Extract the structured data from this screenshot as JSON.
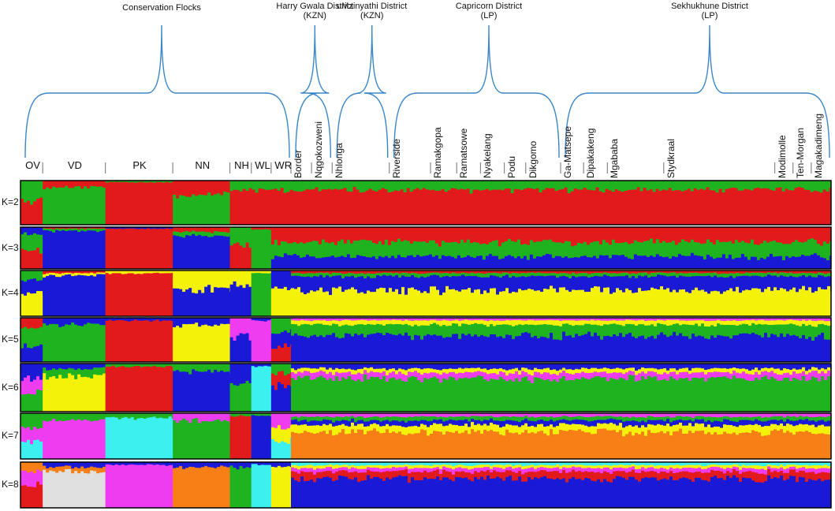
{
  "chart_data": {
    "type": "stacked-bar",
    "description_axis": "individual ancestry proportions",
    "group_titles": [
      {
        "id": "conservation",
        "text": [
          "Conservation Flocks"
        ]
      },
      {
        "id": "harry_gwala",
        "text": [
          "Harry Gwala District",
          "(KZN)"
        ]
      },
      {
        "id": "umzinyathi",
        "text": [
          "uMzinyathi District",
          "(KZN)"
        ]
      },
      {
        "id": "capricorn",
        "text": [
          "Capricorn District",
          "(LP)"
        ]
      },
      {
        "id": "sekhukhune",
        "text": [
          "Sekhukhune District",
          "(LP)"
        ]
      }
    ],
    "populations": [
      {
        "name": "OV",
        "rotated": false,
        "share": 0.028
      },
      {
        "name": "VD",
        "rotated": false,
        "share": 0.079
      },
      {
        "name": "PK",
        "rotated": false,
        "share": 0.085
      },
      {
        "name": "NN",
        "rotated": false,
        "share": 0.072
      },
      {
        "name": "NH",
        "rotated": false,
        "share": 0.027
      },
      {
        "name": "WL",
        "rotated": false,
        "share": 0.025
      },
      {
        "name": "WR",
        "rotated": false,
        "share": 0.025
      },
      {
        "name": "Border",
        "rotated": true,
        "share": 0.026
      },
      {
        "name": "Nqgokozweni",
        "rotated": true,
        "share": 0.026
      },
      {
        "name": "Nhlonga",
        "rotated": true,
        "share": 0.072
      },
      {
        "name": "Riverside",
        "rotated": true,
        "share": 0.052
      },
      {
        "name": "Ramakgopa",
        "rotated": true,
        "share": 0.033
      },
      {
        "name": "Ramatsowe",
        "rotated": true,
        "share": 0.03
      },
      {
        "name": "Nyakelang",
        "rotated": true,
        "share": 0.03
      },
      {
        "name": "Podu",
        "rotated": true,
        "share": 0.027
      },
      {
        "name": "Dikgomo",
        "rotated": true,
        "share": 0.044
      },
      {
        "name": "Ga-Matsepe",
        "rotated": true,
        "share": 0.029
      },
      {
        "name": "Dipakakeng",
        "rotated": true,
        "share": 0.03
      },
      {
        "name": "Mgababa",
        "rotated": true,
        "share": 0.071
      },
      {
        "name": "Stydkraal",
        "rotated": true,
        "share": 0.14
      },
      {
        "name": "Modimolle",
        "rotated": true,
        "share": 0.023
      },
      {
        "name": "Ten-Morgan",
        "rotated": true,
        "share": 0.023
      },
      {
        "name": "Magakadimeng",
        "rotated": true,
        "share": 0.025
      }
    ],
    "k_values": [
      "K=2",
      "K=3",
      "K=4",
      "K=5",
      "K=6",
      "K=7",
      "K=8"
    ],
    "colors": {
      "red": "#e31a1c",
      "green": "#1fb31f",
      "blue": "#1a1ad6",
      "yellow": "#f5f20a",
      "magenta": "#f03cf0",
      "cyan": "#3cf0f0",
      "orange": "#f77f16",
      "grey": "#e0e0e0"
    },
    "panels": [
      {
        "k": "K=2",
        "segments": [
          {
            "pops": [
              "OV"
            ],
            "comp": {
              "red": 0.55,
              "green": 0.45
            }
          },
          {
            "pops": [
              "VD"
            ],
            "comp": {
              "green": 0.85,
              "red": 0.15
            }
          },
          {
            "pops": [
              "PK"
            ],
            "comp": {
              "red": 0.97,
              "green": 0.03
            }
          },
          {
            "pops": [
              "NN"
            ],
            "comp": {
              "green": 0.7,
              "red": 0.3
            }
          },
          {
            "pops": [
              "NH",
              "WL",
              "WR",
              "Border",
              "Nqgokozweni",
              "Nhlonga",
              "Riverside",
              "Ramakgopa",
              "Ramatsowe",
              "Nyakelang",
              "Podu",
              "Dikgomo",
              "Ga-Matsepe",
              "Dipakakeng",
              "Mgababa",
              "Stydkraal",
              "Modimolle",
              "Ten-Morgan",
              "Magakadimeng"
            ],
            "comp": {
              "red": 0.8,
              "green": 0.2
            }
          }
        ]
      },
      {
        "k": "K=3",
        "segments": [
          {
            "pops": [
              "OV"
            ],
            "comp": {
              "red": 0.45,
              "green": 0.4,
              "blue": 0.15
            }
          },
          {
            "pops": [
              "VD"
            ],
            "comp": {
              "blue": 0.92,
              "green": 0.05,
              "red": 0.03
            }
          },
          {
            "pops": [
              "PK"
            ],
            "comp": {
              "red": 0.97,
              "blue": 0.03
            }
          },
          {
            "pops": [
              "NN"
            ],
            "comp": {
              "blue": 0.8,
              "green": 0.1,
              "red": 0.1
            }
          },
          {
            "pops": [
              "NH"
            ],
            "comp": {
              "red": 0.55,
              "green": 0.45
            }
          },
          {
            "pops": [
              "WL"
            ],
            "comp": {
              "green": 0.95,
              "red": 0.05
            }
          },
          {
            "pops": [
              "WR",
              "Border",
              "Nqgokozweni",
              "Nhlonga",
              "Riverside",
              "Ramakgopa",
              "Ramatsowe",
              "Nyakelang",
              "Podu",
              "Dikgomo",
              "Ga-Matsepe",
              "Dipakakeng",
              "Mgababa",
              "Stydkraal",
              "Modimolle",
              "Ten-Morgan",
              "Magakadimeng"
            ],
            "comp": {
              "blue": 0.3,
              "green": 0.35,
              "red": 0.35
            }
          }
        ]
      },
      {
        "k": "K=4",
        "segments": [
          {
            "pops": [
              "OV"
            ],
            "comp": {
              "yellow": 0.5,
              "blue": 0.3,
              "green": 0.2
            }
          },
          {
            "pops": [
              "VD"
            ],
            "comp": {
              "blue": 0.9,
              "yellow": 0.05,
              "red": 0.05
            }
          },
          {
            "pops": [
              "PK"
            ],
            "comp": {
              "red": 0.95,
              "yellow": 0.05
            }
          },
          {
            "pops": [
              "NN"
            ],
            "comp": {
              "blue": 0.6,
              "yellow": 0.4
            }
          },
          {
            "pops": [
              "NH"
            ],
            "comp": {
              "blue": 0.7,
              "yellow": 0.3
            }
          },
          {
            "pops": [
              "WL"
            ],
            "comp": {
              "green": 0.95,
              "yellow": 0.05
            }
          },
          {
            "pops": [
              "WR"
            ],
            "comp": {
              "yellow": 0.6,
              "blue": 0.4
            }
          },
          {
            "pops": [
              "Border",
              "Nqgokozweni",
              "Nhlonga",
              "Riverside",
              "Ramakgopa",
              "Ramatsowe",
              "Nyakelang",
              "Podu",
              "Dikgomo",
              "Ga-Matsepe",
              "Dipakakeng",
              "Mgababa",
              "Stydkraal",
              "Modimolle",
              "Ten-Morgan",
              "Magakadimeng"
            ],
            "comp": {
              "yellow": 0.58,
              "blue": 0.3,
              "green": 0.07,
              "red": 0.05
            }
          }
        ]
      },
      {
        "k": "K=5",
        "segments": [
          {
            "pops": [
              "OV"
            ],
            "comp": {
              "blue": 0.4,
              "green": 0.4,
              "red": 0.2
            }
          },
          {
            "pops": [
              "VD"
            ],
            "comp": {
              "green": 0.85,
              "blue": 0.15
            }
          },
          {
            "pops": [
              "PK"
            ],
            "comp": {
              "red": 0.95,
              "blue": 0.05
            }
          },
          {
            "pops": [
              "NN"
            ],
            "comp": {
              "yellow": 0.85,
              "blue": 0.15
            }
          },
          {
            "pops": [
              "NH"
            ],
            "comp": {
              "blue": 0.6,
              "magenta": 0.4
            }
          },
          {
            "pops": [
              "WL"
            ],
            "comp": {
              "magenta": 0.95,
              "blue": 0.05
            }
          },
          {
            "pops": [
              "WR"
            ],
            "comp": {
              "red": 0.4,
              "blue": 0.3,
              "green": 0.3
            }
          },
          {
            "pops": [
              "Border",
              "Nqgokozweni",
              "Nhlonga",
              "Riverside",
              "Ramakgopa",
              "Ramatsowe",
              "Nyakelang",
              "Podu",
              "Dikgomo",
              "Ga-Matsepe",
              "Dipakakeng",
              "Mgababa",
              "Stydkraal",
              "Modimolle",
              "Ten-Morgan",
              "Magakadimeng"
            ],
            "comp": {
              "blue": 0.6,
              "green": 0.25,
              "yellow": 0.1,
              "magenta": 0.05
            }
          }
        ]
      },
      {
        "k": "K=6",
        "segments": [
          {
            "pops": [
              "OV"
            ],
            "comp": {
              "green": 0.4,
              "magenta": 0.3,
              "blue": 0.3
            }
          },
          {
            "pops": [
              "VD"
            ],
            "comp": {
              "yellow": 0.75,
              "green": 0.15,
              "blue": 0.1
            }
          },
          {
            "pops": [
              "PK"
            ],
            "comp": {
              "red": 0.95,
              "green": 0.05
            }
          },
          {
            "pops": [
              "NN"
            ],
            "comp": {
              "blue": 0.85,
              "green": 0.15
            }
          },
          {
            "pops": [
              "NH"
            ],
            "comp": {
              "green": 0.6,
              "blue": 0.4
            }
          },
          {
            "pops": [
              "WL"
            ],
            "comp": {
              "cyan": 0.95,
              "blue": 0.05
            }
          },
          {
            "pops": [
              "WR"
            ],
            "comp": {
              "blue": 0.55,
              "red": 0.25,
              "green": 0.2
            }
          },
          {
            "pops": [
              "Border",
              "Nqgokozweni",
              "Nhlonga",
              "Riverside",
              "Ramakgopa",
              "Ramatsowe",
              "Nyakelang",
              "Podu",
              "Dikgomo",
              "Ga-Matsepe",
              "Dipakakeng",
              "Mgababa",
              "Stydkraal",
              "Modimolle",
              "Ten-Morgan",
              "Magakadimeng"
            ],
            "comp": {
              "green": 0.7,
              "magenta": 0.12,
              "yellow": 0.08,
              "blue": 0.1
            }
          }
        ]
      },
      {
        "k": "K=7",
        "segments": [
          {
            "pops": [
              "OV"
            ],
            "comp": {
              "cyan": 0.4,
              "magenta": 0.3,
              "green": 0.3
            }
          },
          {
            "pops": [
              "VD"
            ],
            "comp": {
              "magenta": 0.85,
              "green": 0.15
            }
          },
          {
            "pops": [
              "PK"
            ],
            "comp": {
              "cyan": 0.9,
              "green": 0.1
            }
          },
          {
            "pops": [
              "NN"
            ],
            "comp": {
              "green": 0.85,
              "magenta": 0.15
            }
          },
          {
            "pops": [
              "NH"
            ],
            "comp": {
              "red": 0.95,
              "green": 0.05
            }
          },
          {
            "pops": [
              "WL"
            ],
            "comp": {
              "blue": 0.95,
              "green": 0.05
            }
          },
          {
            "pops": [
              "WR"
            ],
            "comp": {
              "cyan": 0.4,
              "yellow": 0.3,
              "magenta": 0.3
            }
          },
          {
            "pops": [
              "Border",
              "Nqgokozweni",
              "Nhlonga",
              "Riverside",
              "Ramakgopa",
              "Ramatsowe",
              "Nyakelang",
              "Podu",
              "Dikgomo",
              "Ga-Matsepe",
              "Dipakakeng",
              "Mgababa",
              "Stydkraal",
              "Modimolle",
              "Ten-Morgan",
              "Magakadimeng"
            ],
            "comp": {
              "orange": 0.6,
              "yellow": 0.15,
              "blue": 0.1,
              "green": 0.08,
              "magenta": 0.07
            }
          }
        ]
      },
      {
        "k": "K=8",
        "segments": [
          {
            "pops": [
              "OV"
            ],
            "comp": {
              "red": 0.5,
              "magenta": 0.3,
              "orange": 0.2
            }
          },
          {
            "pops": [
              "VD"
            ],
            "comp": {
              "grey": 0.8,
              "orange": 0.1,
              "blue": 0.1
            }
          },
          {
            "pops": [
              "PK"
            ],
            "comp": {
              "magenta": 0.95,
              "blue": 0.05
            }
          },
          {
            "pops": [
              "NN"
            ],
            "comp": {
              "orange": 0.9,
              "blue": 0.1
            }
          },
          {
            "pops": [
              "NH"
            ],
            "comp": {
              "green": 0.9,
              "blue": 0.1
            }
          },
          {
            "pops": [
              "WL"
            ],
            "comp": {
              "cyan": 0.95,
              "blue": 0.05
            }
          },
          {
            "pops": [
              "WR"
            ],
            "comp": {
              "yellow": 0.9,
              "blue": 0.1
            }
          },
          {
            "pops": [
              "Border",
              "Nqgokozweni",
              "Nhlonga",
              "Riverside",
              "Ramakgopa",
              "Ramatsowe",
              "Nyakelang",
              "Podu",
              "Dikgomo",
              "Ga-Matsepe",
              "Dipakakeng",
              "Mgababa",
              "Stydkraal",
              "Modimolle",
              "Ten-Morgan",
              "Magakadimeng"
            ],
            "comp": {
              "blue": 0.65,
              "red": 0.15,
              "magenta": 0.08,
              "yellow": 0.06,
              "cyan": 0.06
            }
          }
        ]
      }
    ]
  }
}
